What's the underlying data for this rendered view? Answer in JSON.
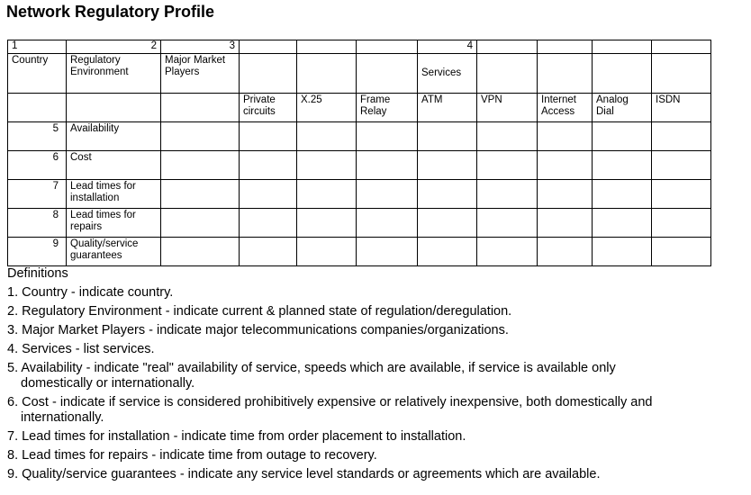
{
  "title": "Network Regulatory Profile",
  "table": {
    "number_row": [
      "1",
      "2",
      "3",
      "4"
    ],
    "headers": {
      "country": "Country",
      "regulatory_environment": "Regulatory Environment",
      "major_market_players": "Major Market Players",
      "services": "Services"
    },
    "services": [
      "Private circuits",
      "X.25",
      "Frame Relay",
      "ATM",
      "VPN",
      "Internet Access",
      "Analog Dial",
      "ISDN"
    ],
    "rows": [
      {
        "num": "5",
        "label": "Availability"
      },
      {
        "num": "6",
        "label": "Cost"
      },
      {
        "num": "7",
        "label": "Lead times for installation"
      },
      {
        "num": "8",
        "label": "Lead times for repairs"
      },
      {
        "num": "9",
        "label": "Quality/service guarantees"
      }
    ]
  },
  "definitions": {
    "heading": "Definitions",
    "items": [
      {
        "first": "1. Country - indicate country.",
        "cont": ""
      },
      {
        "first": "2. Regulatory Environment - indicate current & planned state of regulation/deregulation.",
        "cont": ""
      },
      {
        "first": "3. Major Market Players - indicate major telecommunications companies/organizations.",
        "cont": ""
      },
      {
        "first": "4. Services - list services.",
        "cont": ""
      },
      {
        "first": "5. Availability - indicate \"real\" availability of service, speeds which are available, if service is available only",
        "cont": "domestically or internationally."
      },
      {
        "first": "6. Cost - indicate if service is considered prohibitively expensive or relatively inexpensive, both domestically and",
        "cont": "internationally."
      },
      {
        "first": "7. Lead times for installation - indicate time from order placement to installation.",
        "cont": ""
      },
      {
        "first": "8. Lead times for repairs - indicate time from outage to recovery.",
        "cont": ""
      },
      {
        "first": "9. Quality/service guarantees - indicate any service level standards or agreements which are available.",
        "cont": ""
      }
    ]
  }
}
